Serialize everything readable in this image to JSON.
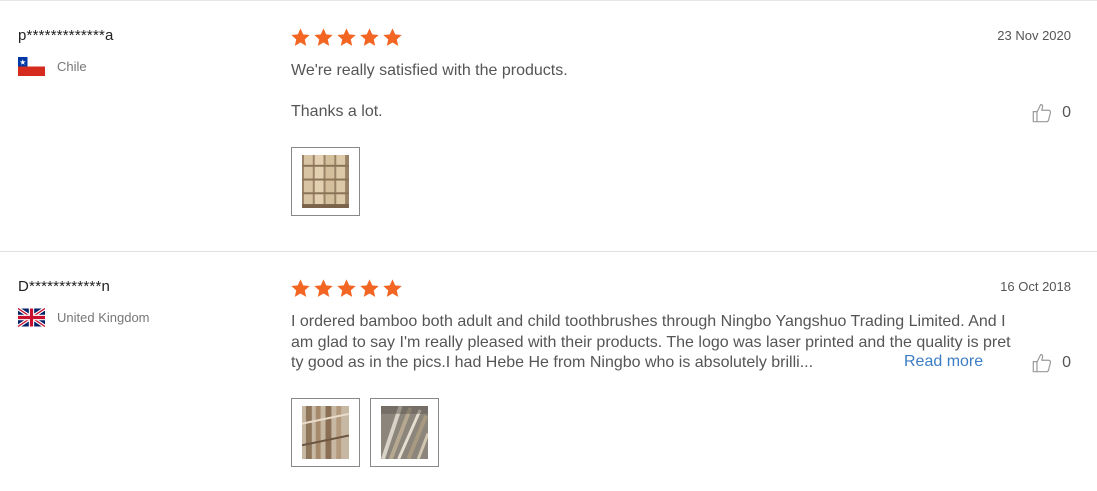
{
  "reviews": [
    {
      "user": "p*************a",
      "country": "Chile",
      "rating": 5,
      "date": "23 Nov 2020",
      "text_lines": [
        "We're really satisfied with the products.",
        "Thanks a lot."
      ],
      "likes": "0",
      "photos": 1
    },
    {
      "user": "D************n",
      "country": "United Kingdom",
      "rating": 5,
      "date": "16 Oct 2018",
      "text_lines": [
        "I ordered bamboo both adult and child toothbrushes through Ningbo Yangshuo Trading Limited. And I",
        "am glad to say I'm really pleased with their products. The logo was laser printed and the quality is pret",
        "ty good as in the pics.I had Hebe He from Ningbo who is absolutely brilli..."
      ],
      "read_more": "Read more",
      "likes": "0",
      "photos": 2
    }
  ],
  "colors": {
    "star": "#f26522",
    "link": "#3b7dc4"
  },
  "icons": {
    "rating": "star-icon",
    "like": "thumbs-up-icon"
  }
}
